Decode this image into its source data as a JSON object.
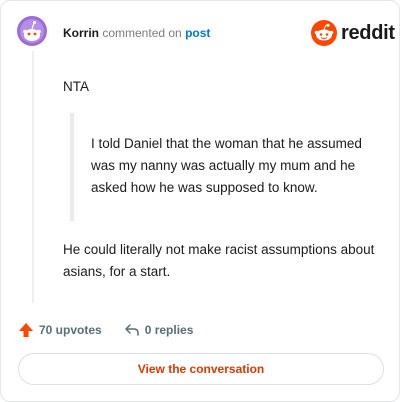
{
  "header": {
    "author": "Korrin",
    "action_text": "commented on",
    "post_link": "post",
    "brand": "reddit"
  },
  "comment": {
    "paragraph1": "NTA",
    "quote": "I told Daniel that the woman that he assumed was my nanny was actually my mum and he asked how he was supposed to know.",
    "paragraph2": "He could literally not make racist assumptions about asians, for a start."
  },
  "actions": {
    "upvotes": "70 upvotes",
    "replies": "0 replies"
  },
  "footer": {
    "button_label": "View the conversation"
  },
  "colors": {
    "brand_orange": "#ff4500",
    "avatar_purple": "#9b6bd6",
    "link_blue": "#0079d3",
    "button_text": "#d93a00"
  },
  "icons": [
    "snoo-avatar-icon",
    "reddit-logo-icon",
    "upvote-arrow-icon",
    "reply-arrow-icon"
  ]
}
